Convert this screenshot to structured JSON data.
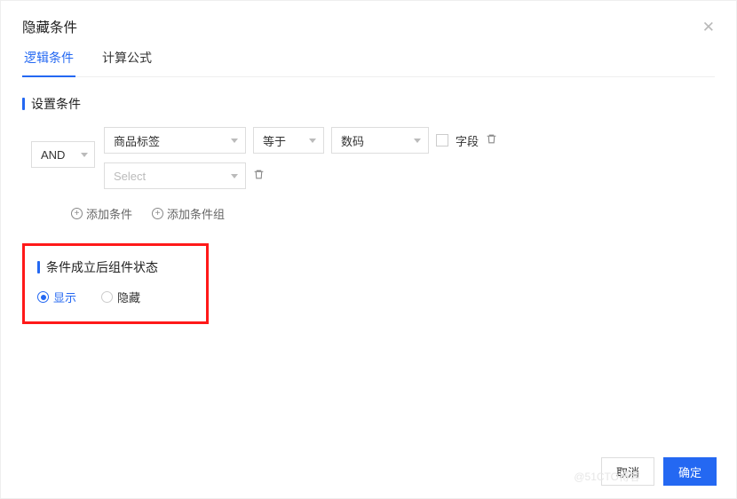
{
  "modal": {
    "title": "隐藏条件"
  },
  "tabs": [
    {
      "label": "逻辑条件",
      "active": true
    },
    {
      "label": "计算公式",
      "active": false
    }
  ],
  "section1": {
    "title": "设置条件"
  },
  "logic": {
    "operator": "AND"
  },
  "condition_rows": [
    {
      "field": "商品标签",
      "operator": "等于",
      "value": "数码",
      "checkbox_label": "字段",
      "checked": false
    },
    {
      "field_placeholder": "Select"
    }
  ],
  "actions": {
    "add_condition": "添加条件",
    "add_condition_group": "添加条件组"
  },
  "section2": {
    "title": "条件成立后组件状态"
  },
  "radio_options": [
    {
      "label": "显示",
      "selected": true
    },
    {
      "label": "隐藏",
      "selected": false
    }
  ],
  "footer": {
    "cancel": "取消",
    "confirm": "确定"
  },
  "watermark": "@51CTO博客"
}
